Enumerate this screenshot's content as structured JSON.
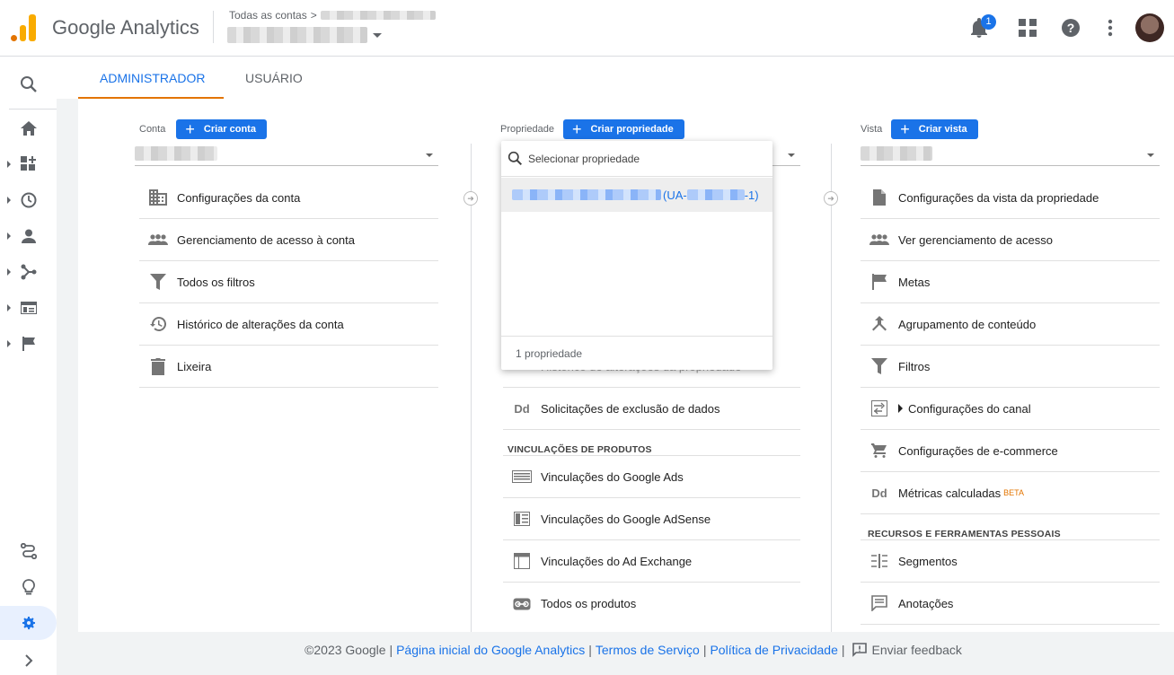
{
  "header": {
    "brand": "Google Analytics",
    "breadcrumb": "Todas as contas",
    "breadcrumb_sep": ">",
    "notifications_count": "1"
  },
  "tabs": [
    {
      "label": "ADMINISTRADOR",
      "active": true
    },
    {
      "label": "USUÁRIO",
      "active": false
    }
  ],
  "account": {
    "label": "Conta",
    "create_label": "Criar conta",
    "items": [
      {
        "label": "Configurações da conta",
        "icon": "building-icon"
      },
      {
        "label": "Gerenciamento de acesso à conta",
        "icon": "people-icon"
      },
      {
        "label": "Todos os filtros",
        "icon": "filter-icon"
      },
      {
        "label": "Histórico de alterações da conta",
        "icon": "history-icon"
      },
      {
        "label": "Lixeira",
        "icon": "trash-icon"
      }
    ]
  },
  "property": {
    "label": "Propriedade",
    "create_label": "Criar propriedade",
    "dropdown": {
      "search_placeholder": "Selecionar propriedade",
      "option_suffix": "(UA-",
      "option_end": "-1)",
      "footer": "1 propriedade"
    },
    "hidden_row": "Histórico de alterações da propriedade",
    "items": [
      {
        "label": "Solicitações de exclusão de dados",
        "icon": "dd-icon"
      }
    ],
    "section_title": "VINCULAÇÕES DE PRODUTOS",
    "links": [
      {
        "label": "Vinculações do Google Ads",
        "icon": "ads-icon"
      },
      {
        "label": "Vinculações do Google AdSense",
        "icon": "adsense-icon"
      },
      {
        "label": "Vinculações do Ad Exchange",
        "icon": "adexchange-icon"
      },
      {
        "label": "Todos os produtos",
        "icon": "link-icon"
      }
    ]
  },
  "view": {
    "label": "Vista",
    "create_label": "Criar vista",
    "items": [
      {
        "label": "Configurações da vista da propriedade",
        "icon": "document-icon"
      },
      {
        "label": "Ver gerenciamento de acesso",
        "icon": "people-icon"
      },
      {
        "label": "Metas",
        "icon": "flag-icon"
      },
      {
        "label": "Agrupamento de conteúdo",
        "icon": "grouping-icon"
      },
      {
        "label": "Filtros",
        "icon": "filter-icon"
      },
      {
        "label": "Configurações do canal",
        "icon": "channel-icon"
      },
      {
        "label": "Configurações de e-commerce",
        "icon": "cart-icon"
      },
      {
        "label": "Métricas calculadas",
        "icon": "dd-icon",
        "badge": "BETA"
      }
    ],
    "section_title": "RECURSOS E FERRAMENTAS PESSOAIS",
    "tools": [
      {
        "label": "Segmentos",
        "icon": "segments-icon"
      },
      {
        "label": "Anotações",
        "icon": "annotation-icon"
      }
    ]
  },
  "footer": {
    "copyright": "©2023 Google |",
    "home": "Página inicial do Google Analytics",
    "terms": "Termos de Serviço",
    "privacy": "Política de Privacidade",
    "sep": "|",
    "feedback": "Enviar feedback"
  },
  "colors": {
    "accent": "#1a73e8",
    "orange": "#e37400",
    "yellow": "#f9ab00"
  }
}
